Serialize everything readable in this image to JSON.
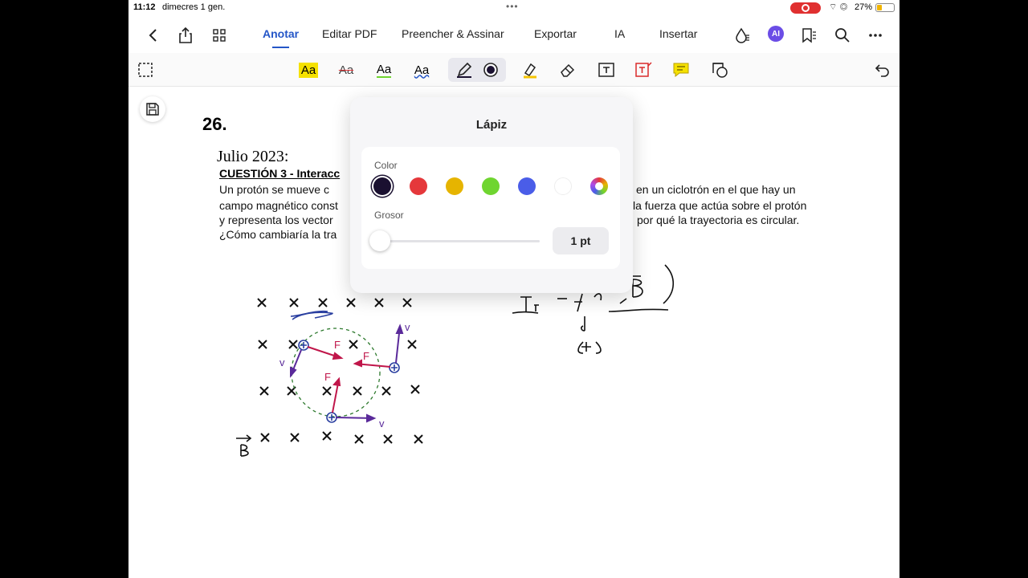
{
  "status_bar": {
    "time": "11:12",
    "date": "dimecres 1 gen.",
    "battery": "27%"
  },
  "nav": {
    "tabs": [
      "Anotar",
      "Editar PDF",
      "Preencher & Assinar",
      "Exportar",
      "IA",
      "Insertar"
    ],
    "active_tab": "Anotar",
    "ai_badge": "AI"
  },
  "toolbar": {
    "text_tools": [
      "Aa",
      "Aa",
      "Aa",
      "Aa"
    ]
  },
  "document": {
    "number": "26.",
    "heading": "Julio 2023:",
    "cuestion": "CUESTIÓN 3 - Interacc",
    "lines_left": [
      "Un protón se mueve c",
      "campo magnético const",
      "y representa los vector",
      "¿Cómo cambiaría la tra"
    ],
    "lines_right": [
      "en un ciclotrón en el que hay un",
      "la fuerza que actúa sobre el protón",
      "por qué la trayectoria es circular."
    ]
  },
  "popup": {
    "title": "Lápiz",
    "color_label": "Color",
    "thickness_label": "Grosor",
    "thickness_value": "1 pt",
    "thickness_fraction": 0.05,
    "colors": [
      "#1a1030",
      "#e5383b",
      "#e6b400",
      "#6fd530",
      "#4a5de8",
      "#ffffff",
      "multicolor"
    ]
  },
  "colors": {
    "accent": "#2456c7",
    "ink_blue": "#2a3fa0",
    "ink_red": "#c0164a",
    "ink_purple": "#5a2a9a",
    "ink_green": "#2e7a2e"
  }
}
